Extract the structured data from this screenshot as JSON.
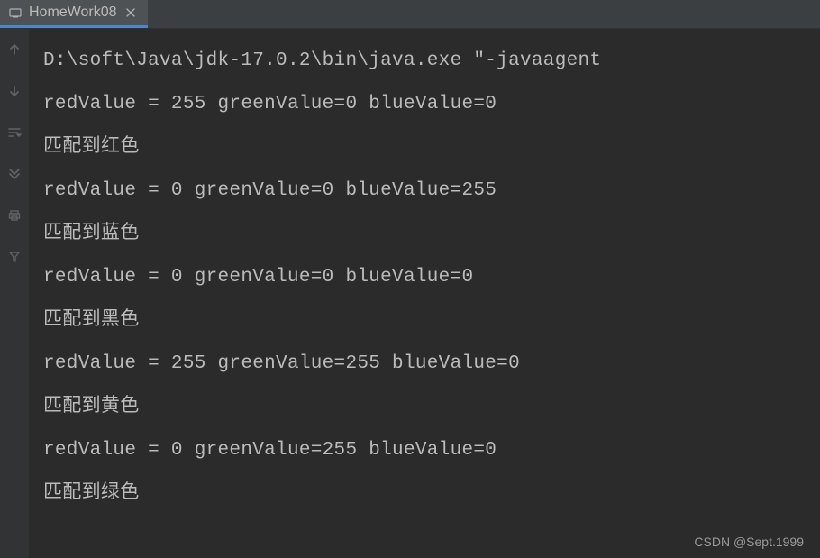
{
  "tab": {
    "title": "HomeWork08"
  },
  "console": {
    "lines": [
      "D:\\soft\\Java\\jdk-17.0.2\\bin\\java.exe \"-javaagent",
      "redValue = 255 greenValue=0 blueValue=0",
      "匹配到红色",
      "redValue = 0 greenValue=0 blueValue=255",
      "匹配到蓝色",
      "redValue = 0 greenValue=0 blueValue=0",
      "匹配到黑色",
      "redValue = 255 greenValue=255 blueValue=0",
      "匹配到黄色",
      "redValue = 0 greenValue=255 blueValue=0",
      "匹配到绿色"
    ]
  },
  "watermark": "CSDN @Sept.1999"
}
